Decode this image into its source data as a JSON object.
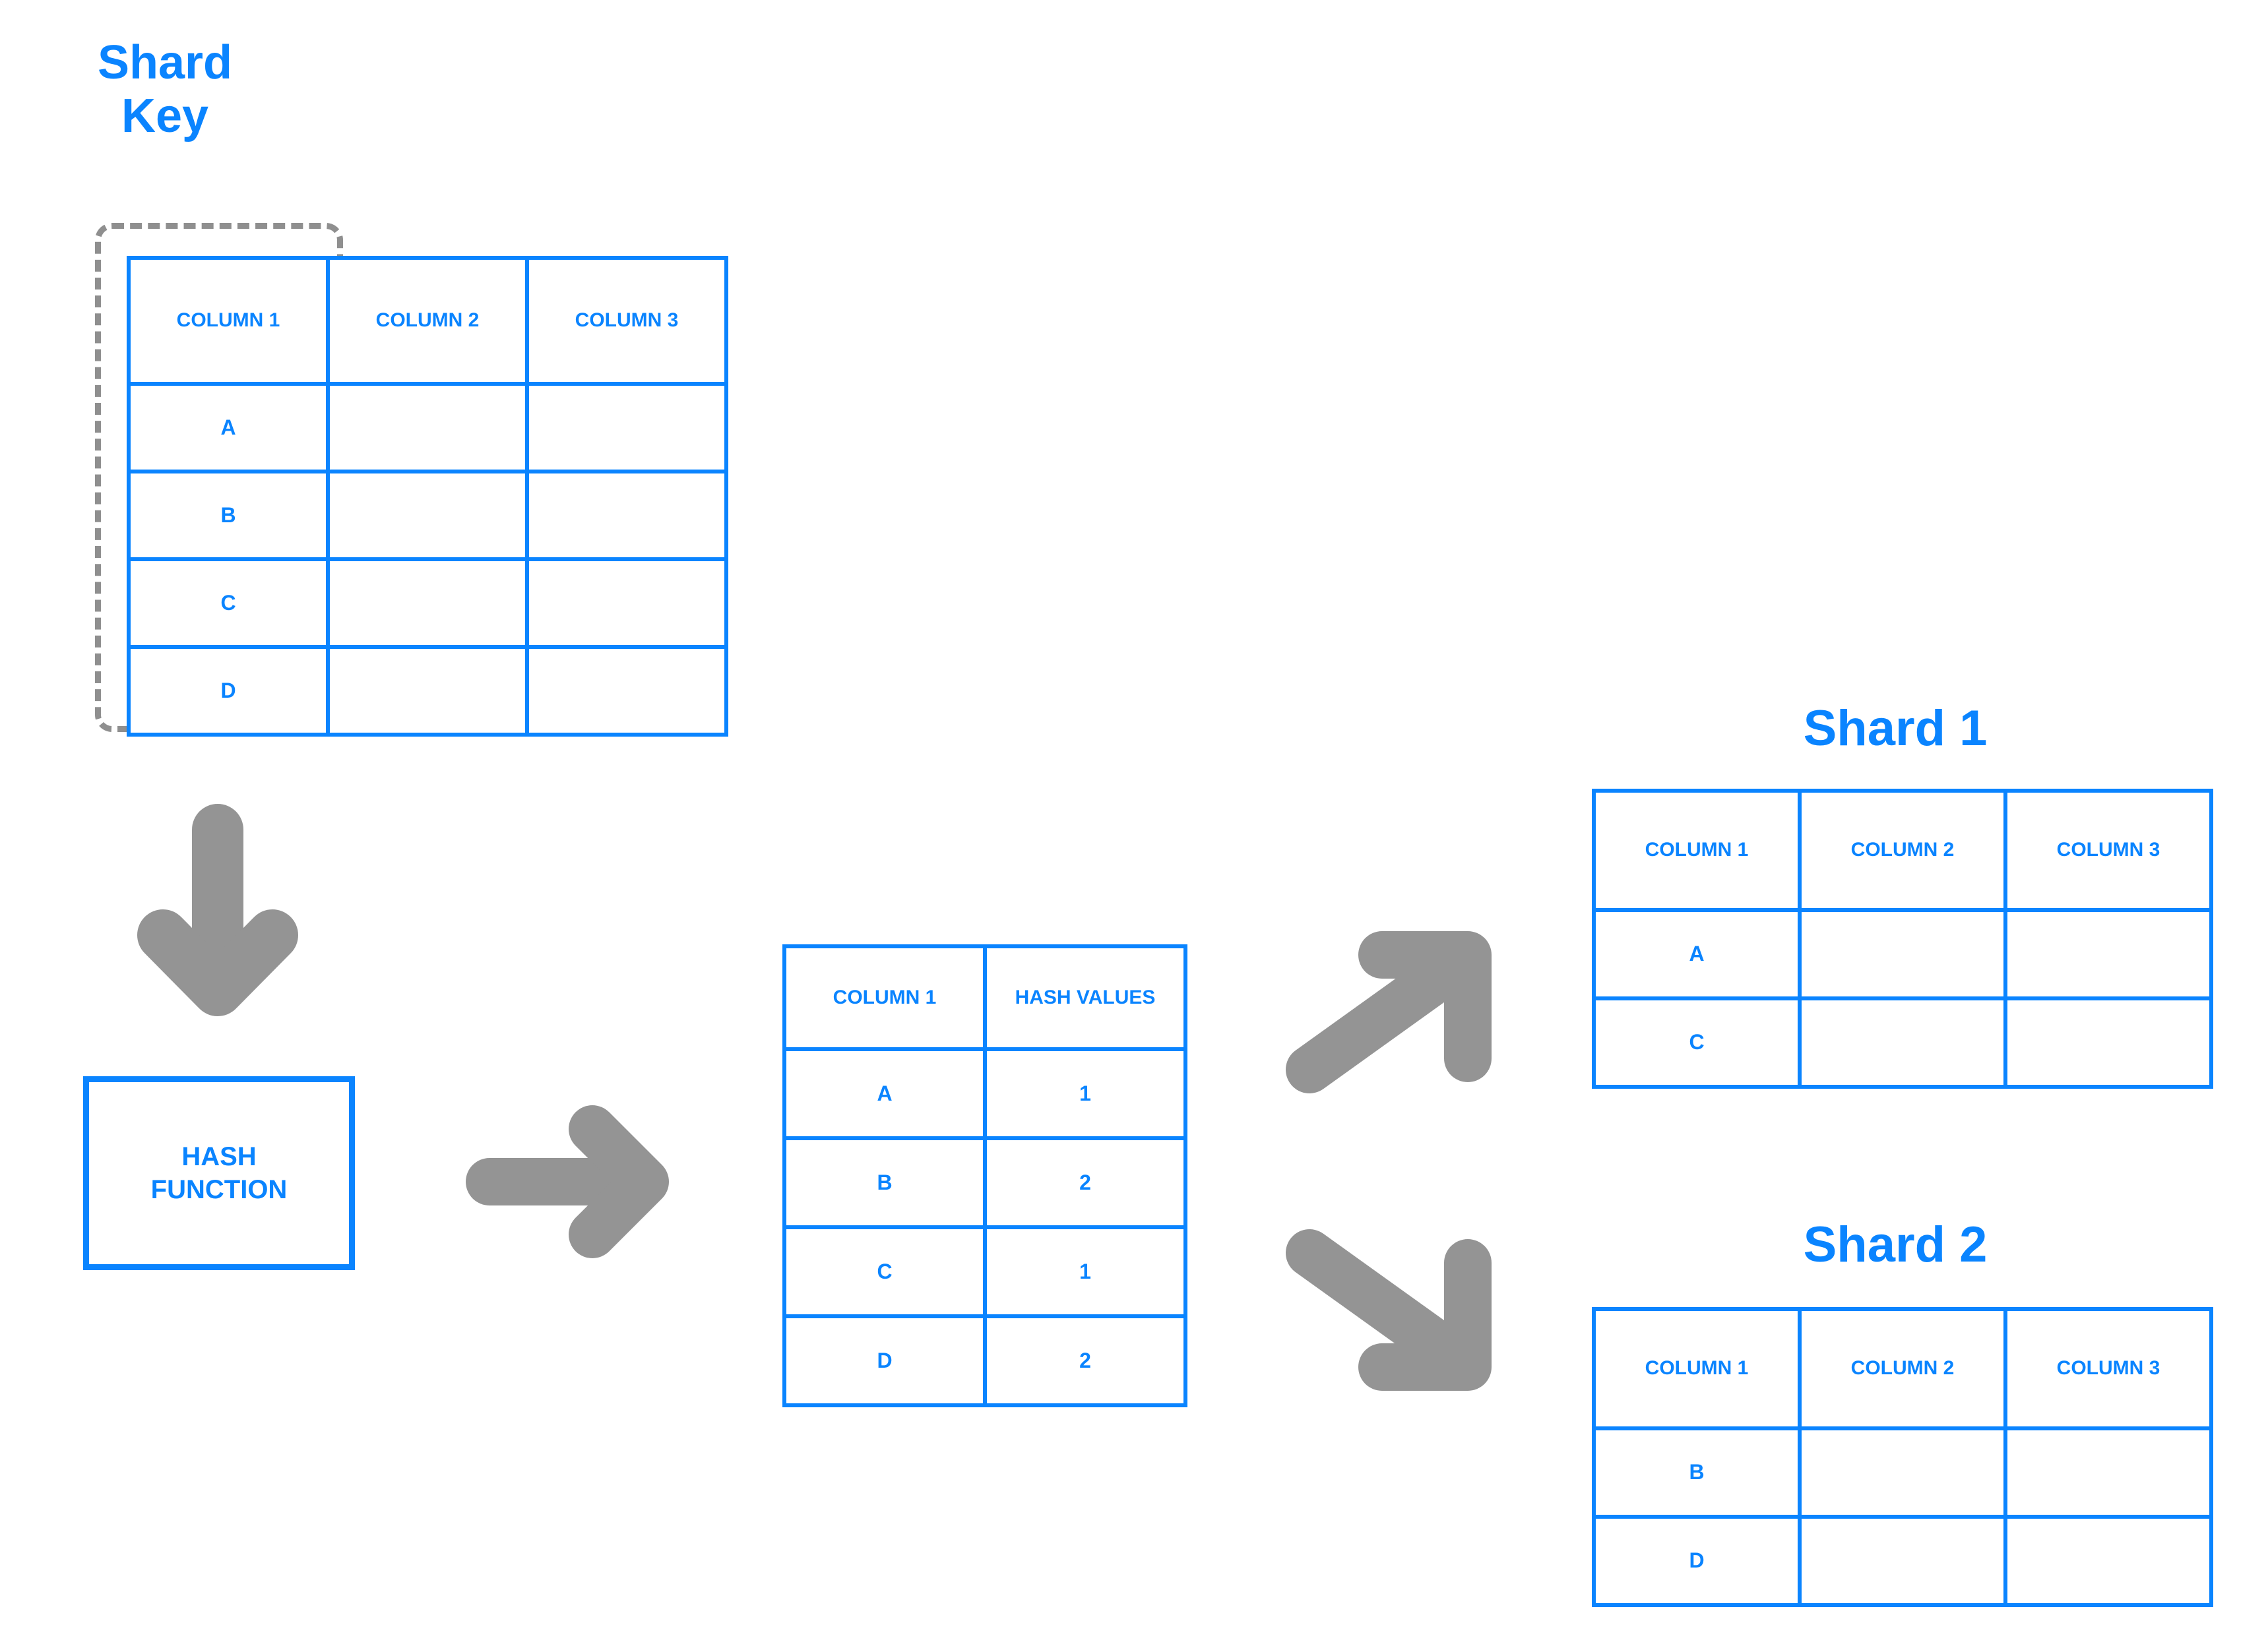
{
  "colors": {
    "accent_blue": "#0a84ff",
    "arrow_gray": "#949494",
    "dashed_gray": "#8f8f8f",
    "background": "#ffffff"
  },
  "labels": {
    "shard_key_title": "Shard\nKey",
    "shard1_title": "Shard 1",
    "shard2_title": "Shard 2",
    "hash_function": "HASH\nFUNCTION"
  },
  "source_table": {
    "headers": [
      "COLUMN\n1",
      "COLUMN\n2",
      "COLUMN\n3"
    ],
    "rows": [
      [
        "A",
        "",
        ""
      ],
      [
        "B",
        "",
        ""
      ],
      [
        "C",
        "",
        ""
      ],
      [
        "D",
        "",
        ""
      ]
    ]
  },
  "hash_table": {
    "headers": [
      "COLUMN\n1",
      "HASH\nVALUES"
    ],
    "rows": [
      [
        "A",
        "1"
      ],
      [
        "B",
        "2"
      ],
      [
        "C",
        "1"
      ],
      [
        "D",
        "2"
      ]
    ]
  },
  "shard1_table": {
    "headers": [
      "COLUMN\n1",
      "COLUMN\n2",
      "COLUMN\n3"
    ],
    "rows": [
      [
        "A",
        "",
        ""
      ],
      [
        "C",
        "",
        ""
      ]
    ]
  },
  "shard2_table": {
    "headers": [
      "COLUMN\n1",
      "COLUMN\n2",
      "COLUMN\n3"
    ],
    "rows": [
      [
        "B",
        "",
        ""
      ],
      [
        "D",
        "",
        ""
      ]
    ]
  },
  "arrows": [
    {
      "name": "arrow-down-to-hash-function",
      "direction": "down"
    },
    {
      "name": "arrow-right-hash-to-values",
      "direction": "right"
    },
    {
      "name": "arrow-up-right-to-shard1",
      "direction": "up-right"
    },
    {
      "name": "arrow-down-right-to-shard2",
      "direction": "down-right"
    }
  ]
}
